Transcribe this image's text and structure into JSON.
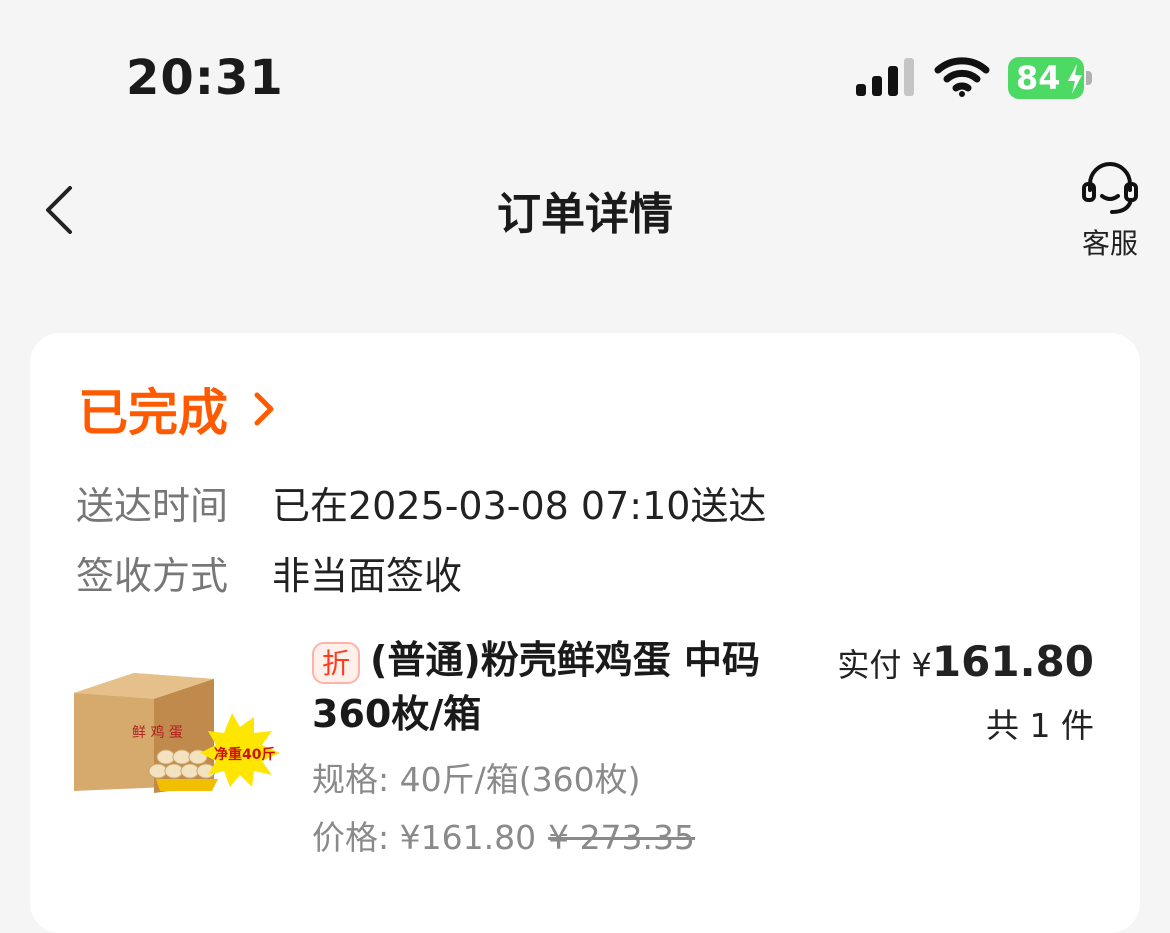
{
  "status_bar": {
    "time": "20:31",
    "battery_level": "84",
    "icons": [
      "cellular-signal-icon",
      "wifi-icon",
      "battery-charging-icon"
    ]
  },
  "nav": {
    "title": "订单详情",
    "back_icon": "chevron-left-icon",
    "service_label": "客服",
    "service_icon": "headset-icon"
  },
  "order": {
    "status": "已完成",
    "status_color": "#ff5a00",
    "delivery_label": "送达时间",
    "delivery_value": "已在2025-03-08 07:10送达",
    "signoff_label": "签收方式",
    "signoff_value": "非当面签收"
  },
  "product": {
    "discount_badge": "折",
    "name": "(普通)粉壳鲜鸡蛋 中码 360枚/箱",
    "spec": "规格: 40斤/箱(360枚)",
    "price": "价格: ¥161.80",
    "original_price": "¥ 273.35",
    "paid_label": "实付 ¥",
    "paid_amount": "161.80",
    "quantity": "共 1 件",
    "image_caption": "净重40斤",
    "image_box_text": "鲜 鸡 蛋"
  }
}
